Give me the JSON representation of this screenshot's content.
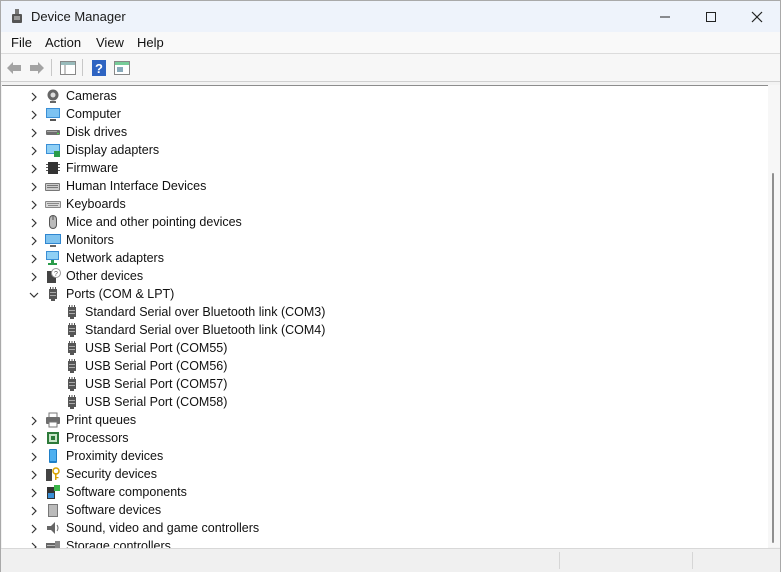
{
  "window": {
    "title": "Device Manager"
  },
  "menu": [
    "File",
    "Action",
    "View",
    "Help"
  ],
  "tree": {
    "categories_top": [
      {
        "label": "Cameras",
        "icon": "camera-icon"
      },
      {
        "label": "Computer",
        "icon": "computer-icon"
      },
      {
        "label": "Disk drives",
        "icon": "disk-drive-icon"
      },
      {
        "label": "Display adapters",
        "icon": "display-adapter-icon"
      },
      {
        "label": "Firmware",
        "icon": "firmware-chip-icon"
      },
      {
        "label": "Human Interface Devices",
        "icon": "hid-icon"
      },
      {
        "label": "Keyboards",
        "icon": "keyboard-icon"
      },
      {
        "label": "Mice and other pointing devices",
        "icon": "mouse-icon"
      },
      {
        "label": "Monitors",
        "icon": "monitor-icon"
      },
      {
        "label": "Network adapters",
        "icon": "network-adapter-icon"
      },
      {
        "label": "Other devices",
        "icon": "unknown-device-icon"
      }
    ],
    "ports": {
      "label": "Ports (COM & LPT)",
      "icon": "port-icon",
      "children": [
        "Standard Serial over Bluetooth link (COM3)",
        "Standard Serial over Bluetooth link (COM4)",
        "USB Serial Port (COM55)",
        "USB Serial Port (COM56)",
        "USB Serial Port (COM57)",
        "USB Serial Port (COM58)"
      ]
    },
    "categories_bottom": [
      {
        "label": "Print queues",
        "icon": "printer-icon"
      },
      {
        "label": "Processors",
        "icon": "processor-icon"
      },
      {
        "label": "Proximity devices",
        "icon": "proximity-icon"
      },
      {
        "label": "Security devices",
        "icon": "security-key-icon"
      },
      {
        "label": "Software components",
        "icon": "software-component-icon"
      },
      {
        "label": "Software devices",
        "icon": "software-device-icon"
      },
      {
        "label": "Sound, video and game controllers",
        "icon": "speaker-icon"
      },
      {
        "label": "Storage controllers",
        "icon": "storage-controller-icon"
      }
    ]
  },
  "colors": {
    "accent": "#2b7bd8",
    "background": "#ffffff"
  }
}
